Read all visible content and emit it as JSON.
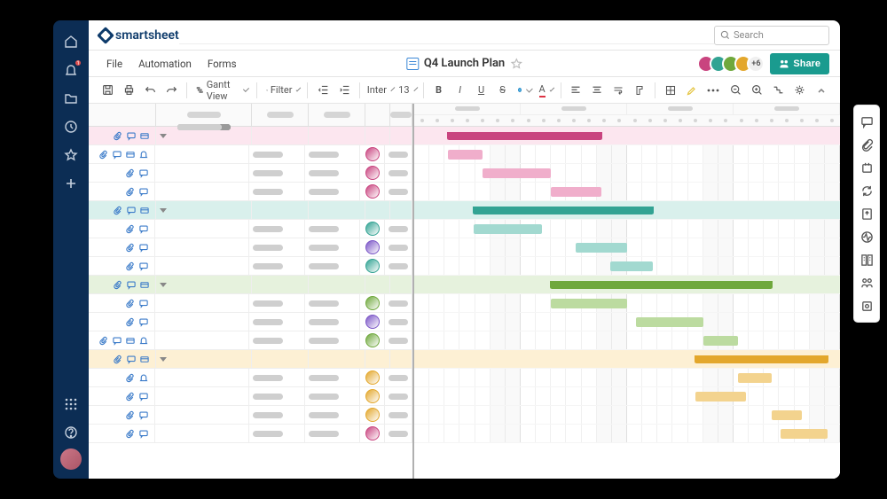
{
  "brand": "smartsheet",
  "search": {
    "placeholder": "Search"
  },
  "nav_rail": {
    "items": [
      "home",
      "notifications",
      "folders",
      "recents",
      "favorites",
      "create"
    ],
    "bottom": [
      "apps",
      "help",
      "profile"
    ],
    "notification_badge": "1"
  },
  "menubar": {
    "items": [
      "File",
      "Automation",
      "Forms"
    ],
    "title": "Q4 Launch Plan",
    "collaborators_more": "+6",
    "share_label": "Share"
  },
  "toolbar": {
    "view_label": "Gantt View",
    "filter_label": "Filter",
    "font_name": "Inter",
    "font_size": "13"
  },
  "colors": {
    "pink_dark": "#c9447f",
    "pink_light": "#f0aecb",
    "pink_row": "#fce6ef",
    "teal_dark": "#32a393",
    "teal_light": "#a2d9d0",
    "teal_row": "#d9f0ec",
    "green_dark": "#6fa83c",
    "green_light": "#bcdba0",
    "green_row": "#e6f2dd",
    "gold_dark": "#e3a72c",
    "gold_light": "#f3d38e",
    "gold_row": "#fdf0d4"
  },
  "avatar_palette": [
    "#c9447f",
    "#32a393",
    "#6fa83c",
    "#e3a72c",
    "#7b55c7",
    "#3b88d6"
  ],
  "chart_data": {
    "type": "gantt",
    "timescale": {
      "major_units": 4,
      "minor_per_major": 7
    },
    "rows": [
      {
        "type": "summary",
        "group": "pink",
        "bar": {
          "start": 8,
          "end": 44
        },
        "icons": [
          "attach",
          "comment",
          "card"
        ]
      },
      {
        "type": "task",
        "group": "pink",
        "owner": 0,
        "bar": {
          "start": 8,
          "end": 16
        },
        "icons": [
          "attach",
          "comment",
          "card",
          "reminder"
        ]
      },
      {
        "type": "task",
        "group": "pink",
        "owner": 0,
        "bar": {
          "start": 16,
          "end": 32
        },
        "icons": [
          "attach",
          "comment"
        ]
      },
      {
        "type": "task",
        "group": "pink",
        "owner": 0,
        "bar": {
          "start": 32,
          "end": 44
        },
        "icons": [
          "attach",
          "comment"
        ]
      },
      {
        "type": "summary",
        "group": "teal",
        "bar": {
          "start": 14,
          "end": 56
        },
        "icons": [
          "attach",
          "comment",
          "card"
        ]
      },
      {
        "type": "task",
        "group": "teal",
        "owner": 1,
        "bar": {
          "start": 14,
          "end": 30
        },
        "icons": [
          "attach",
          "comment"
        ]
      },
      {
        "type": "task",
        "group": "teal",
        "owner": 4,
        "bar": {
          "start": 38,
          "end": 50
        },
        "icons": [
          "attach",
          "comment"
        ]
      },
      {
        "type": "task",
        "group": "teal",
        "owner": 1,
        "bar": {
          "start": 46,
          "end": 56
        },
        "icons": [
          "attach",
          "comment"
        ]
      },
      {
        "type": "summary",
        "group": "green",
        "bar": {
          "start": 32,
          "end": 84
        },
        "icons": [
          "attach",
          "comment",
          "card"
        ]
      },
      {
        "type": "task",
        "group": "green",
        "owner": 2,
        "bar": {
          "start": 32,
          "end": 50
        },
        "icons": [
          "attach",
          "comment"
        ]
      },
      {
        "type": "task",
        "group": "green",
        "owner": 4,
        "bar": {
          "start": 52,
          "end": 68
        },
        "icons": [
          "attach",
          "comment"
        ]
      },
      {
        "type": "task",
        "group": "green",
        "owner": 2,
        "bar": {
          "start": 68,
          "end": 76
        },
        "icons": [
          "attach",
          "comment",
          "card",
          "reminder"
        ]
      },
      {
        "type": "summary",
        "group": "gold",
        "bar": {
          "start": 66,
          "end": 97
        },
        "icons": [
          "attach",
          "comment",
          "card"
        ]
      },
      {
        "type": "task",
        "group": "gold",
        "owner": 3,
        "bar": {
          "start": 76,
          "end": 84
        },
        "icons": [
          "attach",
          "reminder"
        ],
        "spacer": true
      },
      {
        "type": "task",
        "group": "gold",
        "owner": 3,
        "bar": {
          "start": 66,
          "end": 78
        },
        "icons": [
          "attach",
          "comment"
        ]
      },
      {
        "type": "task",
        "group": "gold",
        "owner": 3,
        "bar": {
          "start": 84,
          "end": 91
        },
        "icons": [
          "attach",
          "comment"
        ]
      },
      {
        "type": "task",
        "group": "gold",
        "owner": 0,
        "bar": {
          "start": 86,
          "end": 97
        },
        "icons": [
          "attach",
          "comment"
        ]
      }
    ]
  }
}
